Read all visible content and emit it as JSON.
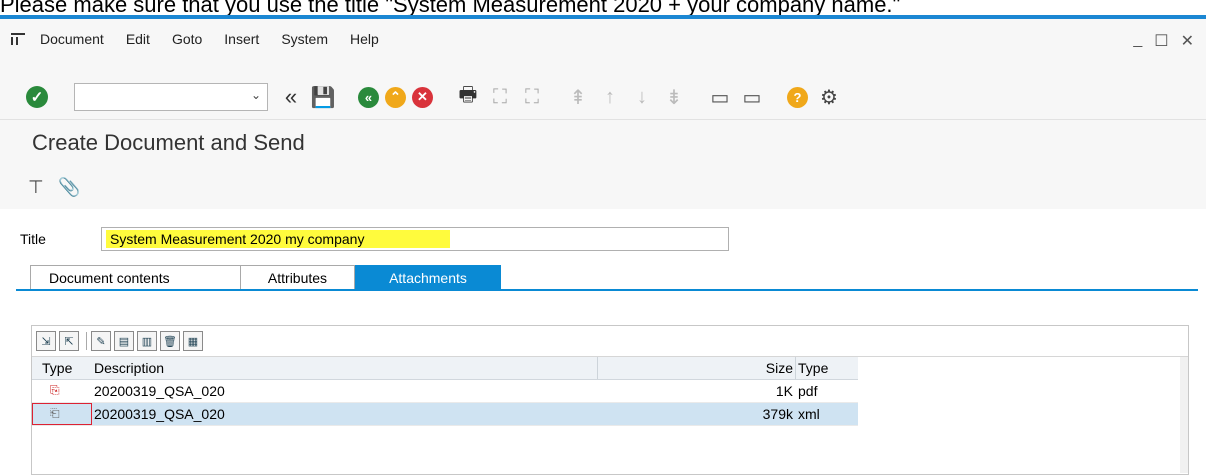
{
  "caption": {
    "text": "Please make sure that you use the title \"System Measurement 2020 + your company name.\""
  },
  "menubar": {
    "items": [
      "Document",
      "Edit",
      "Goto",
      "Insert",
      "System",
      "Help"
    ]
  },
  "window_controls": {
    "minimize": "_",
    "maximize": "☐",
    "close": "✕"
  },
  "toolbar": {
    "command_field_value": ""
  },
  "page": {
    "title": "Create Document and Send"
  },
  "form": {
    "title_label": "Title",
    "title_value": "System Measurement 2020 my company",
    "tabs": [
      {
        "label": "Document contents",
        "active": false
      },
      {
        "label": "Attachments",
        "active": true
      },
      {
        "label": "Attributes",
        "active": false
      }
    ]
  },
  "attachments": {
    "columns": [
      "Type",
      "Description",
      "Size",
      "Type"
    ],
    "rows": [
      {
        "icon": "pdf-icon",
        "description": "20200319_QSA_020",
        "size": "1K",
        "type": "pdf",
        "selected": false
      },
      {
        "icon": "xml-icon",
        "description": "20200319_QSA_020",
        "size": "379k",
        "type": "xml",
        "selected": true
      }
    ]
  },
  "colors": {
    "accent": "#0a8ad4",
    "highlight": "#fffb3d",
    "ok": "#2a8a3c"
  }
}
